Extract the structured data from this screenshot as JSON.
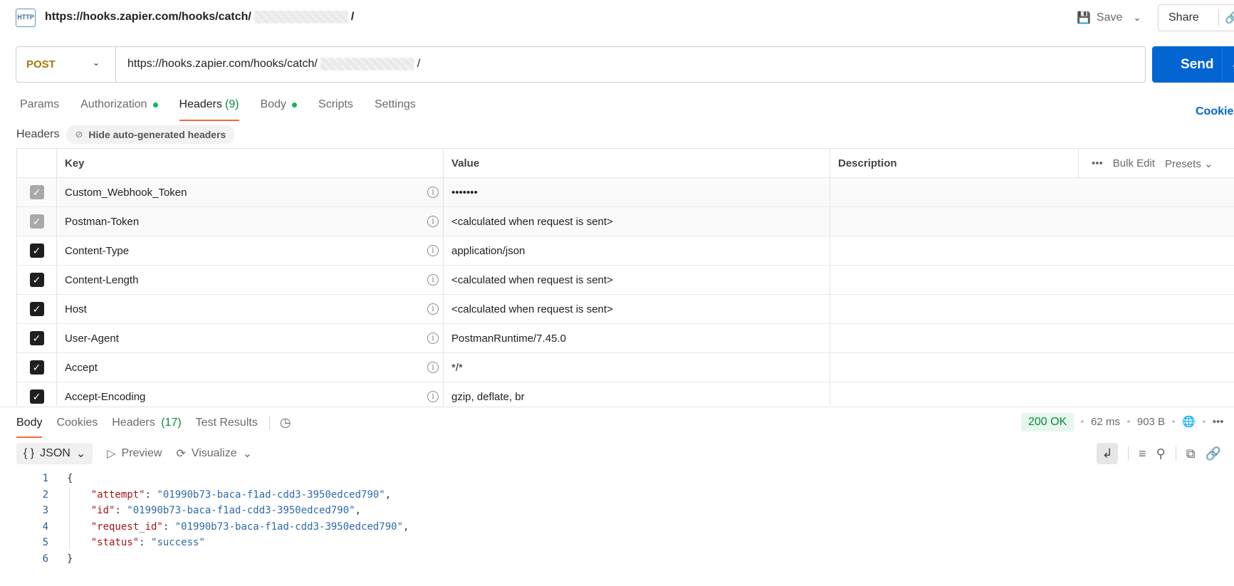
{
  "topbar": {
    "icon": "http-icon",
    "icon_text": "HTTP",
    "url_prefix": "https://hooks.zapier.com/hooks/catch/",
    "url_suffix": "/",
    "save_label": "Save",
    "share_label": "Share"
  },
  "request": {
    "method": "POST",
    "url_prefix": "https://hooks.zapier.com/hooks/catch/",
    "url_suffix": "/",
    "send_label": "Send"
  },
  "request_tabs": [
    {
      "label": "Params",
      "dot": false,
      "count": ""
    },
    {
      "label": "Authorization",
      "dot": true,
      "count": ""
    },
    {
      "label": "Headers",
      "dot": false,
      "count": "(9)",
      "active": true
    },
    {
      "label": "Body",
      "dot": true,
      "count": ""
    },
    {
      "label": "Scripts",
      "dot": false,
      "count": ""
    },
    {
      "label": "Settings",
      "dot": false,
      "count": ""
    }
  ],
  "cookies_link": "Cookies",
  "headers_section": {
    "title": "Headers",
    "hide_auto_label": "Hide auto-generated headers"
  },
  "headers_table": {
    "columns": {
      "key": "Key",
      "value": "Value",
      "description": "Description"
    },
    "bulk_edit": "Bulk Edit",
    "presets": "Presets",
    "rows": [
      {
        "key": "Custom_Webhook_Token",
        "value": "•••••••",
        "checked": "auto"
      },
      {
        "key": "Postman-Token",
        "value": "<calculated when request is sent>",
        "checked": "auto"
      },
      {
        "key": "Content-Type",
        "value": "application/json",
        "checked": "on"
      },
      {
        "key": "Content-Length",
        "value": "<calculated when request is sent>",
        "checked": "on"
      },
      {
        "key": "Host",
        "value": "<calculated when request is sent>",
        "checked": "on"
      },
      {
        "key": "User-Agent",
        "value": "PostmanRuntime/7.45.0",
        "checked": "on"
      },
      {
        "key": "Accept",
        "value": "*/*",
        "checked": "on"
      },
      {
        "key": "Accept-Encoding",
        "value": "gzip, deflate, br",
        "checked": "on"
      }
    ]
  },
  "response": {
    "tabs": [
      {
        "label": "Body",
        "active": true,
        "count": ""
      },
      {
        "label": "Cookies",
        "count": ""
      },
      {
        "label": "Headers",
        "count": "(17)"
      },
      {
        "label": "Test Results",
        "count": ""
      }
    ],
    "status": "200 OK",
    "time": "62 ms",
    "size": "903 B",
    "format": "JSON",
    "preview_label": "Preview",
    "visualize_label": "Visualize",
    "body_lines": [
      {
        "n": "1",
        "text": "{"
      },
      {
        "n": "2",
        "key": "\"attempt\"",
        "value": "\"01990b73-baca-f1ad-cdd3-3950edced790\"",
        "trail": ","
      },
      {
        "n": "3",
        "key": "\"id\"",
        "value": "\"01990b73-baca-f1ad-cdd3-3950edced790\"",
        "trail": ","
      },
      {
        "n": "4",
        "key": "\"request_id\"",
        "value": "\"01990b73-baca-f1ad-cdd3-3950edced790\"",
        "trail": ","
      },
      {
        "n": "5",
        "key": "\"status\"",
        "value": "\"success\"",
        "trail": ""
      },
      {
        "n": "6",
        "text": "}"
      }
    ]
  },
  "colors": {
    "send": "#0265d2",
    "method": "#a97a07",
    "active_tab_underline": "#f26b3a",
    "status_ok": "#0a8a42",
    "dot_green": "#0cbb52"
  }
}
